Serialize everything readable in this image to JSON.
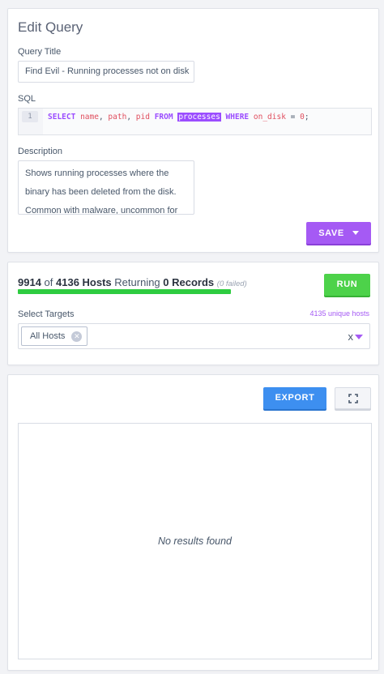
{
  "edit_query": {
    "heading": "Edit Query",
    "title_label": "Query Title",
    "title_value": "Find Evil - Running processes not on disk",
    "sql_label": "SQL",
    "sql_line_number": "1",
    "sql_tokens": {
      "select": "SELECT",
      "name": "name",
      "path": "path",
      "pid": "pid",
      "from": "FROM",
      "table": "processes",
      "where": "WHERE",
      "on_disk": "on_disk",
      "equals": "=",
      "zero": "0",
      "semicolon": ";"
    },
    "description_label": "Description",
    "description_value": "Shows running processes where the binary has been deleted from the disk. Common with malware, uncommon for",
    "save_label": "SAVE",
    "accent_color": "#a55af4"
  },
  "targets": {
    "hosts_responded": "9914",
    "of_text": "of",
    "hosts_total": "4136 Hosts",
    "returning_text": "Returning",
    "records": "0 Records",
    "failed": "(0 failed)",
    "progress_fraction": 1.0,
    "run_label": "RUN",
    "select_label": "Select Targets",
    "unique_hosts": "4135 unique hosts",
    "selected_target": "All Hosts",
    "chip_remove_icon": "close-circle-icon",
    "clear_icon": "x",
    "dropdown_icon": "caret-down-icon",
    "run_color": "#4dd24a",
    "progress_color": "#2ecc40"
  },
  "results": {
    "export_label": "EXPORT",
    "fullscreen_icon": "fullscreen-icon",
    "empty_text": "No results found",
    "export_color": "#3d8ff0"
  }
}
